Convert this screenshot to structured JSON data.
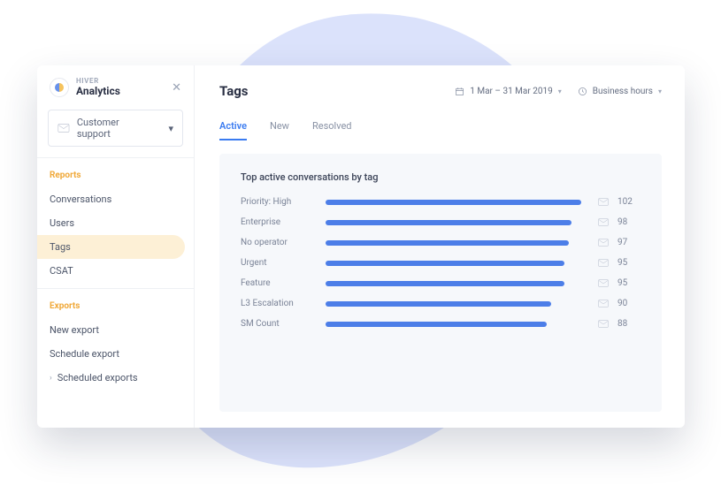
{
  "sidebar": {
    "eyebrow": "HIVER",
    "title": "Analytics",
    "dropdown_label": "Customer support",
    "sections": {
      "reports": {
        "title": "Reports",
        "items": [
          "Conversations",
          "Users",
          "Tags",
          "CSAT"
        ],
        "active_index": 2
      },
      "exports": {
        "title": "Exports",
        "items": [
          "New export",
          "Schedule export",
          "Scheduled exports"
        ]
      }
    }
  },
  "header": {
    "page_title": "Tags",
    "date_range": "1 Mar – 31 Mar 2019",
    "hours_label": "Business hours"
  },
  "tabs": {
    "items": [
      "Active",
      "New",
      "Resolved"
    ],
    "active_index": 0
  },
  "panel": {
    "title": "Top active conversations by tag"
  },
  "chart_data": {
    "type": "bar",
    "title": "Top active conversations by tag",
    "xlabel": "",
    "ylabel": "",
    "ylim": [
      0,
      105
    ],
    "categories": [
      "Priority: High",
      "Enterprise",
      "No operator",
      "Urgent",
      "Feature",
      "L3 Escalation",
      "SM Count"
    ],
    "values": [
      102,
      98,
      97,
      95,
      95,
      90,
      88
    ]
  },
  "colors": {
    "accent_blue": "#3a7bf0",
    "bar_blue": "#4c7ee8",
    "orange": "#f0a93a"
  }
}
